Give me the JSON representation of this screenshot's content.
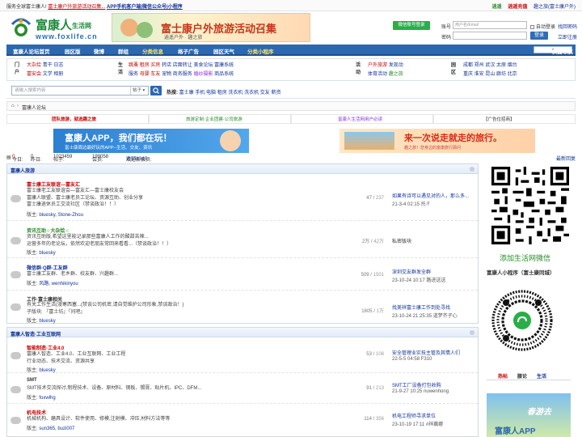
{
  "topbar": {
    "welcome": "服务全球富士康人!",
    "promo": "富士康户外旅游活动召集...",
    "app_promo": "APP手机客户端|微信公众号|小程序",
    "right_links": [
      "逍遥",
      "逍遥充值",
      "趣之旅(富士康户外)"
    ]
  },
  "logo": {
    "name": "富康人",
    "sub": "生活网",
    "domain": "www.foxlife.cn"
  },
  "header_banner": {
    "title": "富士康户外旅游活动召集",
    "sub": "逍遥户外 · 趣之旅"
  },
  "login": {
    "wechat_login": "微信账号登录",
    "user_label": "账号",
    "user_placeholder": "用户名/Email",
    "remember": "自动登录",
    "forgot": "找回密码",
    "pass_label": "密码",
    "login_btn": "登录",
    "register": "立即注册"
  },
  "nav": {
    "items": [
      "富康人论坛首页",
      "园区版",
      "微博",
      "群组",
      "分类信息",
      "格子广告",
      "园区天气",
      "分类小程序"
    ],
    "quick": "快捷导航"
  },
  "links": {
    "cat1": "门户",
    "cat1_row1": {
      "a": "大杂烩",
      "b": "青干",
      "c": "日志"
    },
    "cat1_row2": {
      "a": "富安会",
      "b": "文学",
      "c": "相册"
    },
    "cat2": "生活",
    "cat2_row1": {
      "a": "跳蚤",
      "b": "租房",
      "c": "买房",
      "d": "转店",
      "e": "店面转让",
      "f": "美食论坛",
      "g": "富康系统"
    },
    "cat2_row2": {
      "a": "服务",
      "b": "母婴",
      "c": "车友",
      "d": "宠物",
      "e": "商务服务",
      "f": "婚纱摄影",
      "g": "商品系统"
    },
    "cat3": "活动",
    "cat3_row1": {
      "a": "户外旅游",
      "b": "发现动"
    },
    "cat3_row2": {
      "a": "体育活动",
      "b": "趣之旅"
    },
    "cat4": "园区",
    "cat4_row1": "成都 郑州 武汉 太原 烟台",
    "cat4_row2": "重庆 淮安 昆山 廊坊 北京"
  },
  "search": {
    "placeholder": "请输入搜索内容",
    "scope": "帖子",
    "hot_label": "热搜:",
    "hot": [
      "富士康",
      "手机",
      "电脑",
      "租房",
      "洗衣机",
      "洗衣机",
      "交友",
      "薪资"
    ]
  },
  "breadcrumb": {
    "home_icon": "home-icon",
    "sep": "›",
    "current": "富康人论坛"
  },
  "notices": [
    "团队旅游，就选趣之旅",
    "旅游定制·企业团建·公司旅游",
    "富康人生活网用户必读",
    "【广告位招商】"
  ],
  "ads": {
    "ad1_title": "富康人APP，我们都在玩！",
    "ad1_sub": "富士康周边最好玩的APP--生活、交友、资讯",
    "ad2_title": "来一次说走就走的旅行。",
    "ad2_sub": "趣之旅！您身边的富康旅行顾问"
  },
  "stats": {
    "today_label": "今日:",
    "today": "0",
    "yesterday_label": "昨日:",
    "yesterday": "0",
    "posts_label": "帖子:",
    "posts": "1023459",
    "members_label": "会员:",
    "members": "199058",
    "newest_label": "欢迎新会员:",
    "newest": "逍551345",
    "latest": "最新回复"
  },
  "sections": [
    {
      "title": "富康人旅游",
      "forums": [
        {
          "name": "富士康工友联谊—富友汇",
          "desc": [
            "富士康老工友联谊会—富友汇—富士康校友会",
            "富康人联盟、富士康老员工论坛、资源互助、创业分享",
            "富士康退休员工交流社区（禁谈政治！！）"
          ],
          "mod_label": "版主:",
          "mods": "bluesky, Stone-Zhou",
          "count": "47",
          "total": "237",
          "last_title": "如果有诗可以遇见对的人，那么多...",
          "last_meta": "21-3-4 02:15 托ㄔ"
        },
        {
          "name": "资讯互助☆大杂烩☆",
          "desc": [
            "资讯互助版,希望这里能记录那些富康人工作的酸甜苦辣...",
            "运营多年的老论坛，依然欢迎老朋友常回来看看...（禁谈政治！！）"
          ],
          "mod_label": "版主:",
          "mods": "bluesky",
          "count": "2万",
          "total": "42万",
          "last_title": "私密版块",
          "last_meta": ""
        },
        {
          "name": "微信群·Q群·工友群",
          "desc": [
            "富士康工友群、老乡群、校友群、兴趣群..."
          ],
          "mod_label": "版主:",
          "mods": "风路, wenhikinyou",
          "count": "509",
          "total": "1501",
          "last_title": "深圳交友群发全群",
          "last_meta": "23-10-24 10:17 路进送送"
        },
        {
          "name": "工作·富士康相关",
          "desc": [
            "有关工作生活(漫寒西塞...(禁谈公司机密,请自觉维护公司形象,禁谈政治！)",
            "子版块: 『富士坊』『问吧』"
          ],
          "mod_label": "版主:",
          "mods": "bluesky",
          "count": "1605",
          "total": "1万",
          "last_title": "找美祥富士康工作到处寻找",
          "last_meta": "23-10-24 21:25:35 道梦齐子心"
        }
      ]
    },
    {
      "title": "富康人智造·工业互联网",
      "forums": [
        {
          "name": "智能制造·工业4.0",
          "desc": [
            "富康人智造、工业4.0、工业互联网、工业工程",
            "行业动态、技术交流、资源共享"
          ],
          "mod_label": "版主:",
          "mods": "bluesky",
          "count": "53",
          "total": "108",
          "last_title": "安全管理业实技主管及其情人们",
          "last_meta": "22-5-5 04:58 F310"
        },
        {
          "name": "SMT",
          "desc": [
            "SMT技术交流探讨,制程技术、设备、原材料、钢板、锡膏、贴片机、IPC、DFM..."
          ],
          "mod_label": "版主:",
          "mods": "foxwlhg",
          "count": "91",
          "total": "213",
          "last_title": "SMT工厂设备打包收购",
          "last_meta": "21-9-27 10:25 nuwenhong"
        },
        {
          "name": "机电技术",
          "desc": [
            "机械机构、磨具设计、软件使用、修模,注射模、冲压,材料方法等等"
          ],
          "mod_label": "版主:",
          "mods": "sun365, buzi007",
          "count": "114",
          "total": "356",
          "last_title": "机电工程师寻求单位",
          "last_meta": "23-10-19 17:11 #祥赢娜"
        }
      ]
    }
  ],
  "sidebar": {
    "wechat_caption": "添加生活网微信",
    "miniprogram_caption": "富康人小程序（富士康同城）",
    "tabs": [
      "热帖",
      "腰论",
      "生活"
    ],
    "banner_title": "春游去",
    "banner_brand": "富康人APP"
  },
  "colors": {
    "brand_blue": "#2b68b0",
    "brand_green": "#2a8a2a",
    "accent_red": "#cc0000"
  }
}
